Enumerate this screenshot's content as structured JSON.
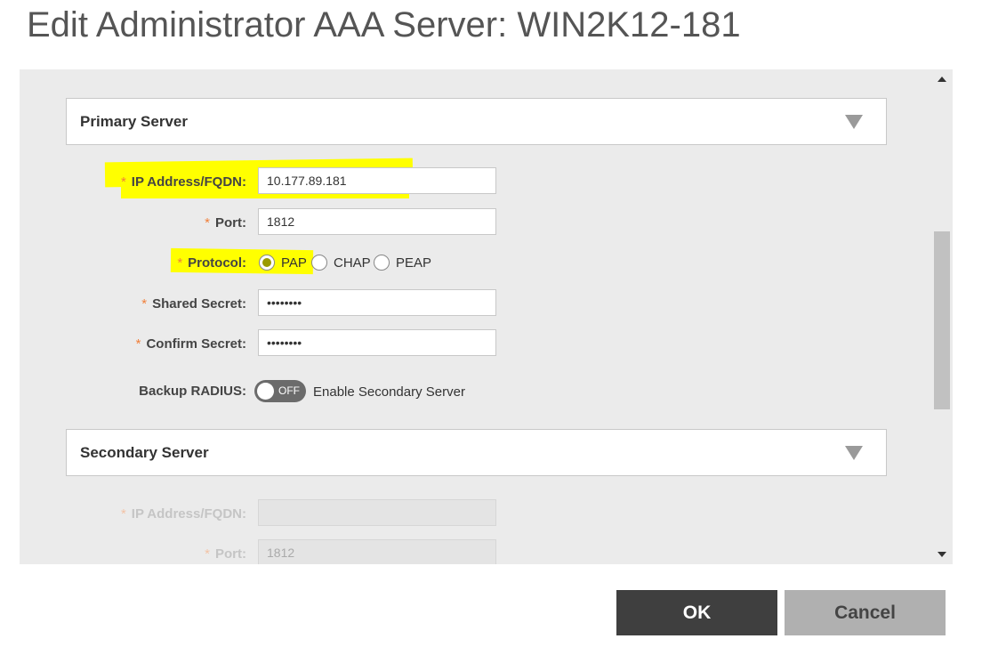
{
  "dialog": {
    "title": "Edit Administrator AAA Server: WIN2K12-181"
  },
  "primary": {
    "header": "Primary Server",
    "ip_label": "IP Address/FQDN:",
    "ip_value": "10.177.89.181",
    "port_label": "Port:",
    "port_value": "1812",
    "protocol_label": "Protocol:",
    "protocol_options": [
      "PAP",
      "CHAP",
      "PEAP"
    ],
    "protocol_selected": "PAP",
    "secret_label": "Shared Secret:",
    "secret_value": "••••••••",
    "confirm_label": "Confirm Secret:",
    "confirm_value": "••••••••",
    "required_mark": "*"
  },
  "backup": {
    "label": "Backup RADIUS:",
    "toggle_state": "OFF",
    "description": "Enable Secondary Server"
  },
  "secondary": {
    "header": "Secondary Server",
    "ip_label": "IP Address/FQDN:",
    "ip_value": "",
    "port_label": "Port:",
    "port_value": "1812"
  },
  "buttons": {
    "ok": "OK",
    "cancel": "Cancel"
  },
  "colors": {
    "highlight": "#ffff00",
    "required": "#f07f3a",
    "ok_bg": "#3f3f3f",
    "cancel_bg": "#b0b0b0"
  }
}
